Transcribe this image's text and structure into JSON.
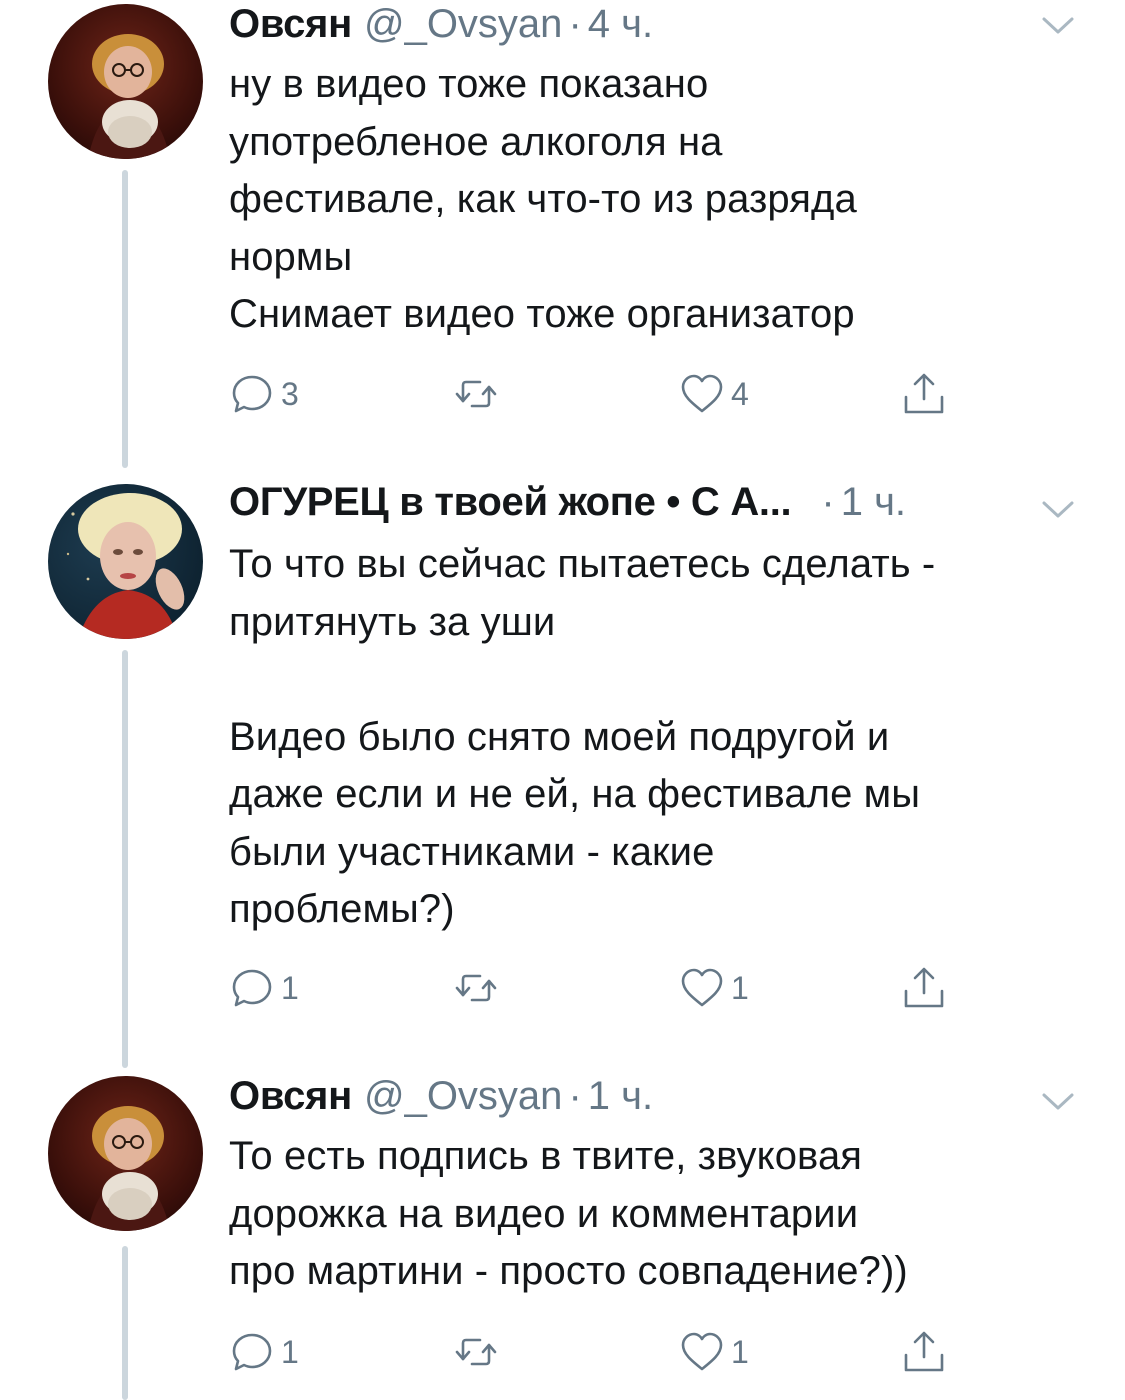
{
  "colors": {
    "text_primary": "#14171a",
    "text_secondary": "#657786",
    "thread_line": "#ccd6dd"
  },
  "tweets": [
    {
      "name": "Овсян",
      "handle": "@_Ovsyan",
      "separator": "·",
      "time": "4 ч.",
      "text": "ну в видео тоже показано\nупотребленое алкоголя на\nфестивале, как что-то из разряда\nнормы\nСнимает видео тоже организатор",
      "actions": {
        "reply_count": "3",
        "retweet_count": "",
        "like_count": "4"
      },
      "icons": [
        "reply-icon",
        "retweet-icon",
        "like-icon",
        "share-icon",
        "chevron-down-icon"
      ]
    },
    {
      "name": "ОГУРЕЦ в твоей жопе • С А...",
      "handle": "",
      "separator": "·",
      "time": "1 ч.",
      "text": "То что вы сейчас пытаетесь сделать -\nпритянуть за уши\n\nВидео было снято моей подругой и\nдаже если и не ей, на фестивале мы\nбыли участниками - какие\nпроблемы?)",
      "actions": {
        "reply_count": "1",
        "retweet_count": "",
        "like_count": "1"
      },
      "icons": [
        "reply-icon",
        "retweet-icon",
        "like-icon",
        "share-icon",
        "chevron-down-icon"
      ]
    },
    {
      "name": "Овсян",
      "handle": "@_Ovsyan",
      "separator": "·",
      "time": "1 ч.",
      "text": "То есть подпись в твите, звуковая\nдорожка на видео и комментарии\nпро мартини - просто совпадение?))",
      "actions": {
        "reply_count": "1",
        "retweet_count": "",
        "like_count": "1"
      },
      "icons": [
        "reply-icon",
        "retweet-icon",
        "like-icon",
        "share-icon",
        "chevron-down-icon"
      ]
    }
  ]
}
